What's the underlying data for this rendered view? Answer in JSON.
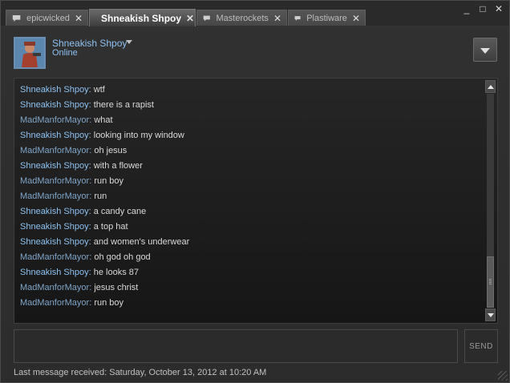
{
  "tabs": [
    {
      "label": "epicwicked",
      "active": false
    },
    {
      "label": "Shneakish Shpoy",
      "active": true
    },
    {
      "label": "Masterockets",
      "active": false
    },
    {
      "label": "Plastiware",
      "active": false
    }
  ],
  "window_controls": {
    "minimize": "_",
    "maximize": "□",
    "close": "✕"
  },
  "tab_close_glyph": "✕",
  "header": {
    "name": "Shneakish Shpoy",
    "status": "Online"
  },
  "messages": [
    {
      "sender": "Shneakish Shpoy",
      "text": "wtf"
    },
    {
      "sender": "Shneakish Shpoy",
      "text": "there is a rapist"
    },
    {
      "sender": "MadManforMayor",
      "text": "what"
    },
    {
      "sender": "Shneakish Shpoy",
      "text": "looking into my window"
    },
    {
      "sender": "MadManforMayor",
      "text": "oh jesus"
    },
    {
      "sender": "Shneakish Shpoy",
      "text": "with a flower"
    },
    {
      "sender": "MadManforMayor",
      "text": "run boy"
    },
    {
      "sender": "MadManforMayor",
      "text": "run"
    },
    {
      "sender": "Shneakish Shpoy",
      "text": "a candy cane"
    },
    {
      "sender": "Shneakish Shpoy",
      "text": "a top hat"
    },
    {
      "sender": "Shneakish Shpoy",
      "text": "and women's underwear"
    },
    {
      "sender": "MadManforMayor",
      "text": "oh god oh god"
    },
    {
      "sender": "Shneakish Shpoy",
      "text": "he looks 87"
    },
    {
      "sender": "MadManforMayor",
      "text": "jesus christ"
    },
    {
      "sender": "MadManforMayor",
      "text": "run boy"
    }
  ],
  "send_label": "SEND",
  "footer": {
    "last_message": "Last message received: Saturday, October 13, 2012 at 10:20 AM"
  },
  "colors": {
    "name_blue": "#8ec1f0",
    "other_blue": "#7fa5c9",
    "message_text": "#d9d9d9",
    "background": "#2c2c2c"
  }
}
